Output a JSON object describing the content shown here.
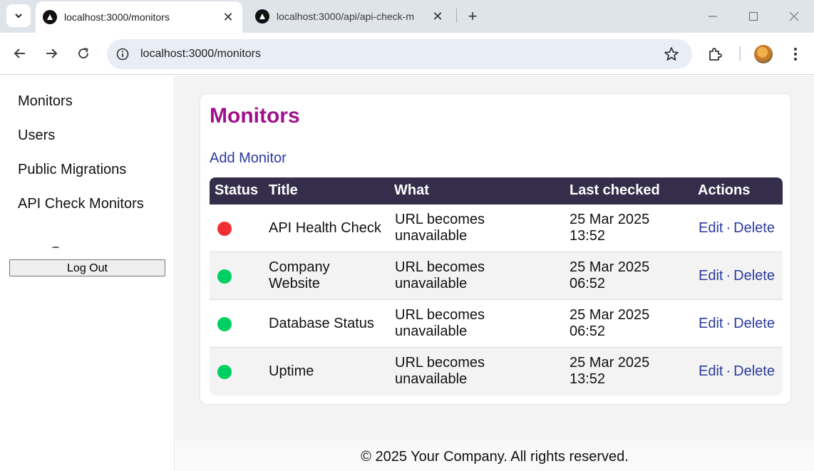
{
  "browser": {
    "tabs": [
      {
        "title": "localhost:3000/monitors",
        "active": true
      },
      {
        "title": "localhost:3000/api/api-check-m",
        "active": false
      }
    ],
    "address": "localhost:3000/monitors"
  },
  "sidebar": {
    "items": [
      {
        "label": "Monitors"
      },
      {
        "label": "Users"
      },
      {
        "label": "Public Migrations"
      },
      {
        "label": "API Check Monitors"
      }
    ],
    "logout_label": "Log Out"
  },
  "main": {
    "title": "Monitors",
    "add_label": "Add Monitor",
    "table": {
      "headers": {
        "status": "Status",
        "title": "Title",
        "what": "What",
        "last_checked": "Last checked",
        "actions": "Actions"
      },
      "rows": [
        {
          "status": "down",
          "status_color": "#f03030",
          "title_1": "API Health Check",
          "title_2": "",
          "what_1": "URL becomes",
          "what_2": "unavailable",
          "checked_1": "25 Mar 2025",
          "checked_2": "13:52",
          "edit": "Edit",
          "sep": "·",
          "delete": "Delete"
        },
        {
          "status": "up",
          "status_color": "#00d062",
          "title_1": "Company",
          "title_2": "Website",
          "what_1": "URL becomes",
          "what_2": "unavailable",
          "checked_1": "25 Mar 2025",
          "checked_2": "06:52",
          "edit": "Edit",
          "sep": "·",
          "delete": "Delete"
        },
        {
          "status": "up",
          "status_color": "#00d062",
          "title_1": "Database Status",
          "title_2": "",
          "what_1": "URL becomes",
          "what_2": "unavailable",
          "checked_1": "25 Mar 2025",
          "checked_2": "06:52",
          "edit": "Edit",
          "sep": "·",
          "delete": "Delete"
        },
        {
          "status": "up",
          "status_color": "#00d062",
          "title_1": "Uptime",
          "title_2": "",
          "what_1": "URL becomes",
          "what_2": "unavailable",
          "checked_1": "25 Mar 2025",
          "checked_2": "13:52",
          "edit": "Edit",
          "sep": "·",
          "delete": "Delete"
        }
      ]
    }
  },
  "footer": {
    "text": "© 2025 Your Company. All rights reserved."
  },
  "colors": {
    "accent_title": "#a0128c",
    "link": "#2c3a9f",
    "table_header": "#352e4b"
  },
  "icons": [
    "tab-search-icon",
    "nextjs-favicon-icon",
    "close-icon",
    "plus-icon",
    "minimize-icon",
    "maximize-icon",
    "window-close-icon",
    "back-arrow-icon",
    "forward-arrow-icon",
    "reload-icon",
    "site-info-icon",
    "star-icon",
    "extensions-icon",
    "profile-avatar",
    "more-menu-icon"
  ]
}
